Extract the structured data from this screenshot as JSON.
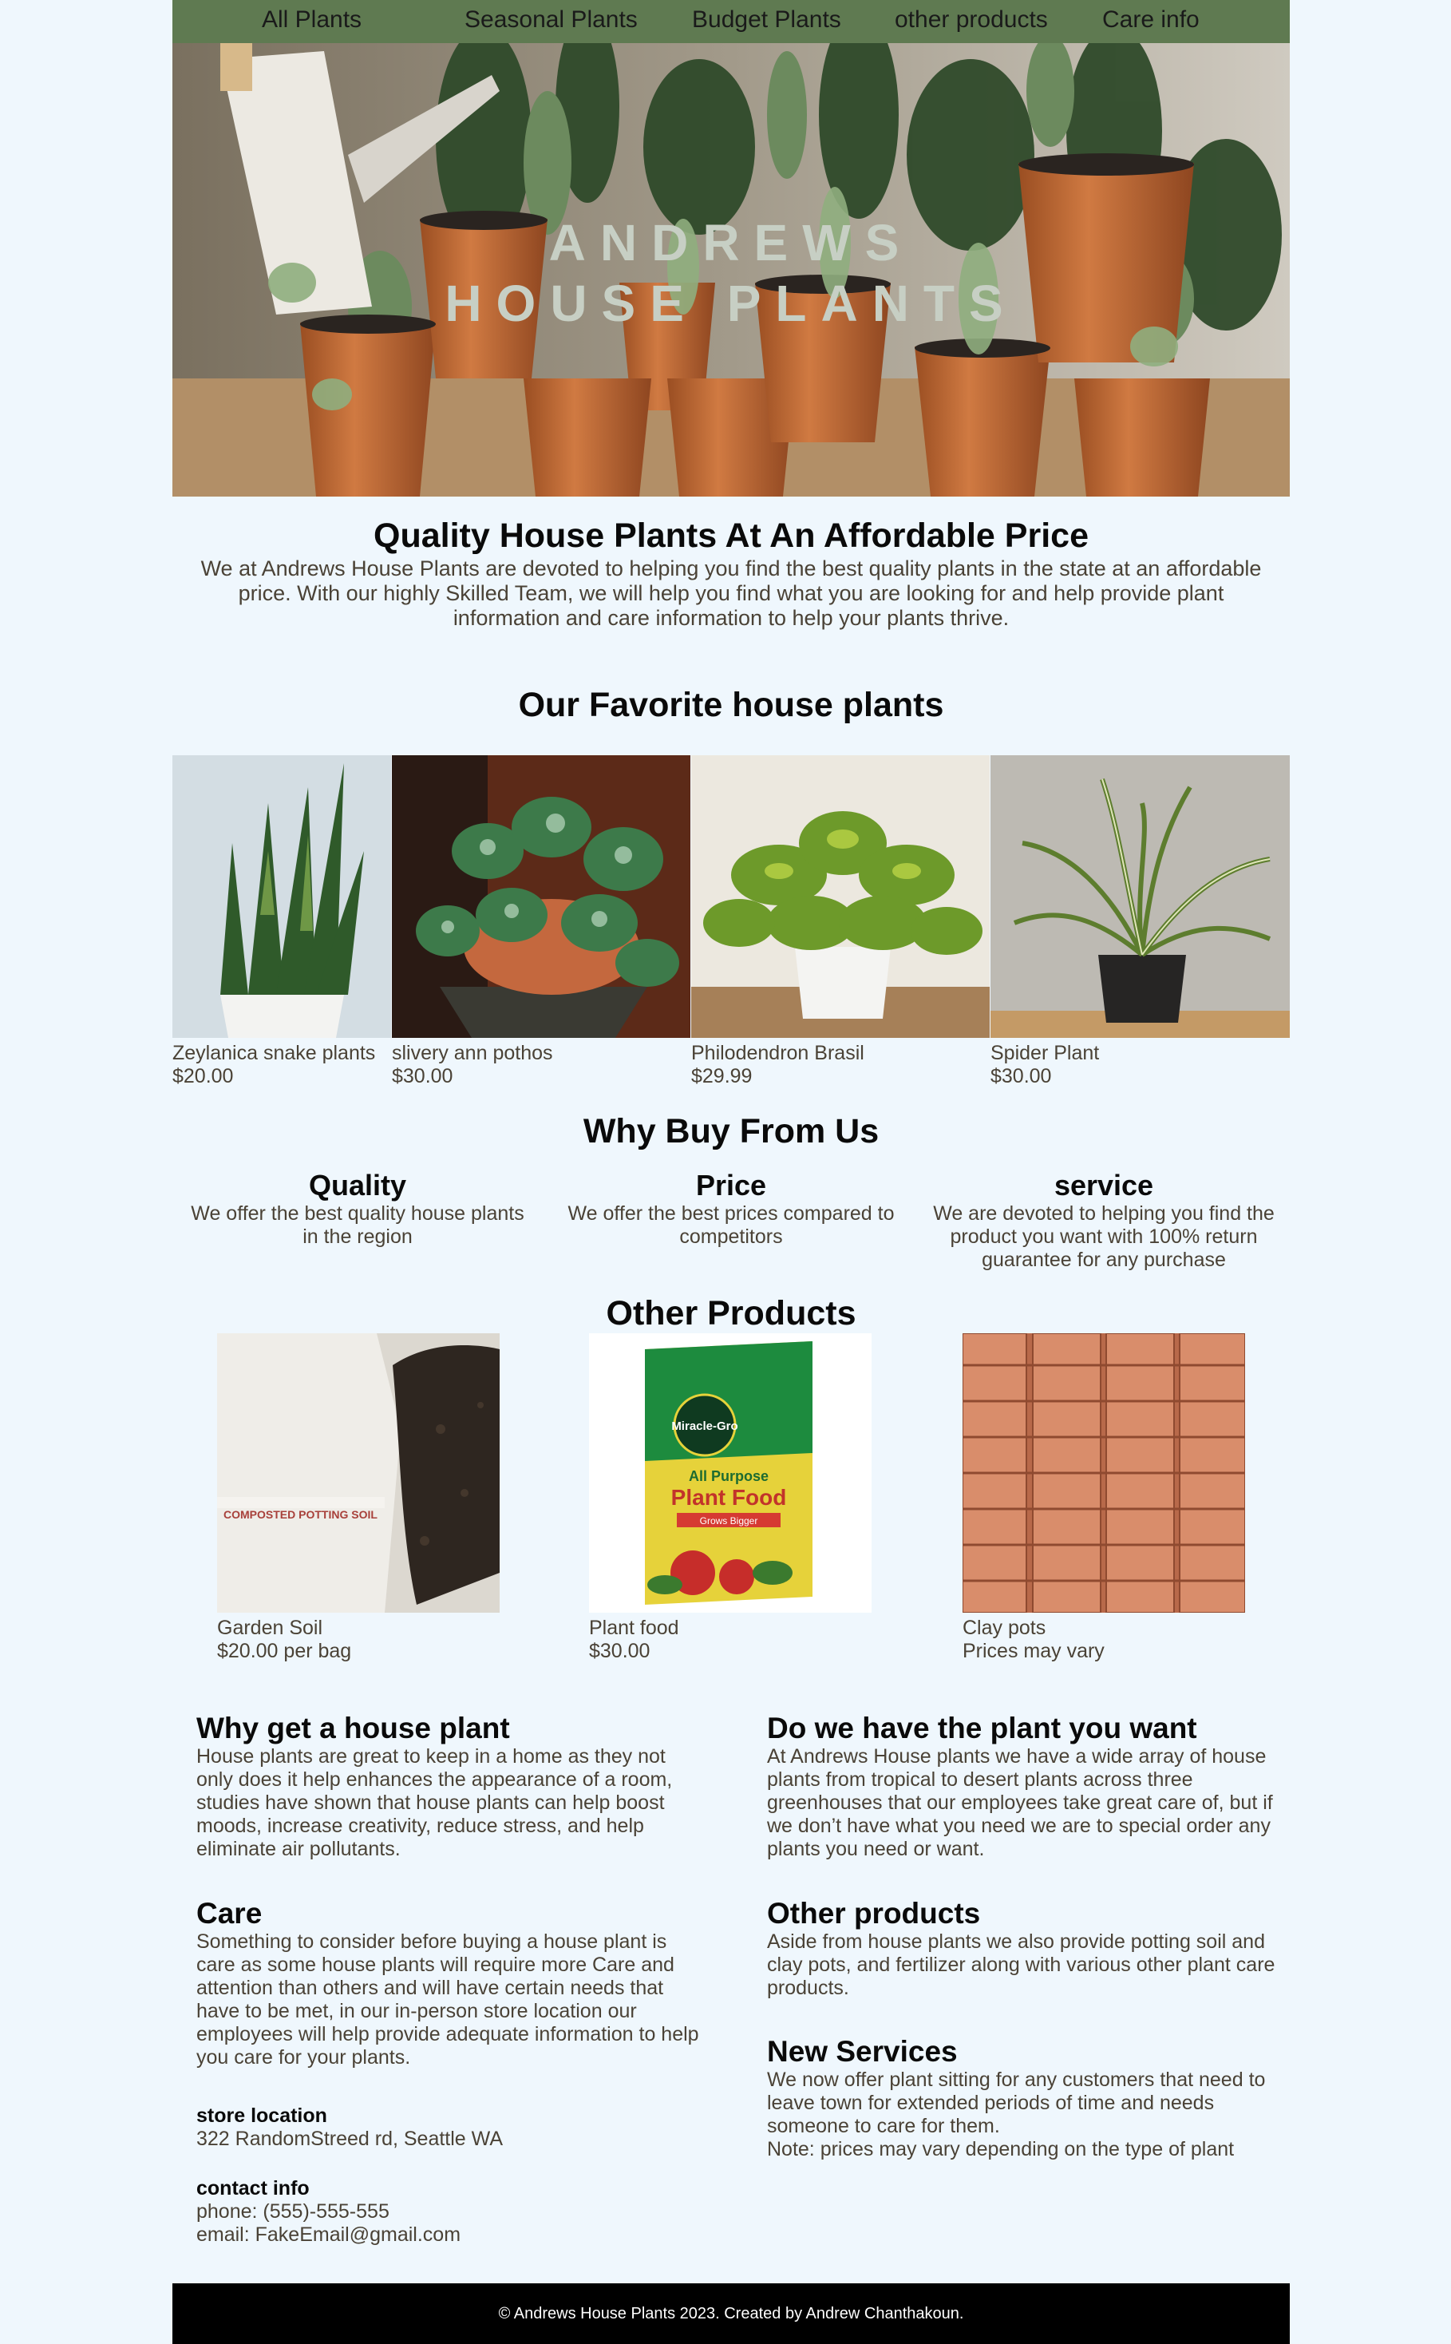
{
  "nav": {
    "items": [
      "All Plants",
      "Seasonal Plants",
      "Budget Plants",
      "other products",
      "Care info"
    ]
  },
  "hero": {
    "line1": "ANDREWS",
    "line2": "HOUSE PLANTS"
  },
  "intro": {
    "heading": "Quality House Plants At An Affordable Price",
    "text": "We at Andrews House Plants are devoted to helping you find the best quality plants in the state at an affordable price. With our highly Skilled Team, we will help you find what you are looking for and help provide plant information and care information to help your plants thrive."
  },
  "favorites": {
    "heading": "Our Favorite house plants",
    "items": [
      {
        "name": "Zeylanica snake plants",
        "price": "$20.00"
      },
      {
        "name": "slivery ann pothos",
        "price": "$30.00"
      },
      {
        "name": "Philodendron Brasil",
        "price": "$29.99"
      },
      {
        "name": "Spider Plant",
        "price": "$30.00"
      }
    ]
  },
  "why": {
    "heading": "Why Buy From Us",
    "cols": [
      {
        "title": "Quality",
        "text": "We offer the best quality house plants in the region"
      },
      {
        "title": "Price",
        "text": "We offer the best prices compared to competitors"
      },
      {
        "title": "service",
        "text": "We are devoted to helping you find the product you want with 100% return guarantee for any purchase"
      }
    ]
  },
  "other_products": {
    "heading": "Other Products",
    "items": [
      {
        "name": "Garden Soil",
        "price": "$20.00 per bag",
        "bag_text": "COMPOSTED POTTING SOIL"
      },
      {
        "name": "Plant food",
        "price": "$30.00",
        "brand": "Miracle-Gro",
        "label1": "All Purpose",
        "label2": "Plant Food",
        "label3": "Grows Bigger"
      },
      {
        "name": "Clay pots",
        "price": "Prices may vary"
      }
    ]
  },
  "info": {
    "why_plant": {
      "title": "Why get a house plant",
      "text": "House plants are great to keep in a home as they not only does it help enhances the appearance of a room, studies have shown that house plants can help boost moods, increase creativity, reduce stress, and help eliminate air pollutants."
    },
    "care": {
      "title": "Care",
      "text": "Something to consider before buying a house plant is care as some house plants will require more Care and attention than others and will have certain needs that have to be met, in our in-person store location our employees will help provide adequate information to help you care for your plants."
    },
    "have_plant": {
      "title": "Do we have the plant you want",
      "text": "At Andrews House plants we have a wide array of house plants from tropical to desert plants across three greenhouses that our employees take great care of, but if we don’t have what you need we are to special order any plants you need or want."
    },
    "other": {
      "title": "Other products",
      "text": "Aside from house plants we also provide potting soil and clay pots, and fertilizer along with various other plant care products."
    },
    "services": {
      "title": "New Services",
      "text": "We now offer plant sitting for any customers that need to leave town for extended periods of time and needs someone to care for them.",
      "note": "Note: prices may vary depending on the type of plant"
    },
    "store": {
      "label": "store location",
      "address": "322 RandomStreed rd, Seattle WA"
    },
    "contact": {
      "label": "contact info",
      "phone": "phone: (555)-555-555",
      "email": "email: FakeEmail@gmail.com"
    }
  },
  "footer": {
    "text": "© Andrews House Plants 2023. Created by Andrew Chanthakoun."
  }
}
